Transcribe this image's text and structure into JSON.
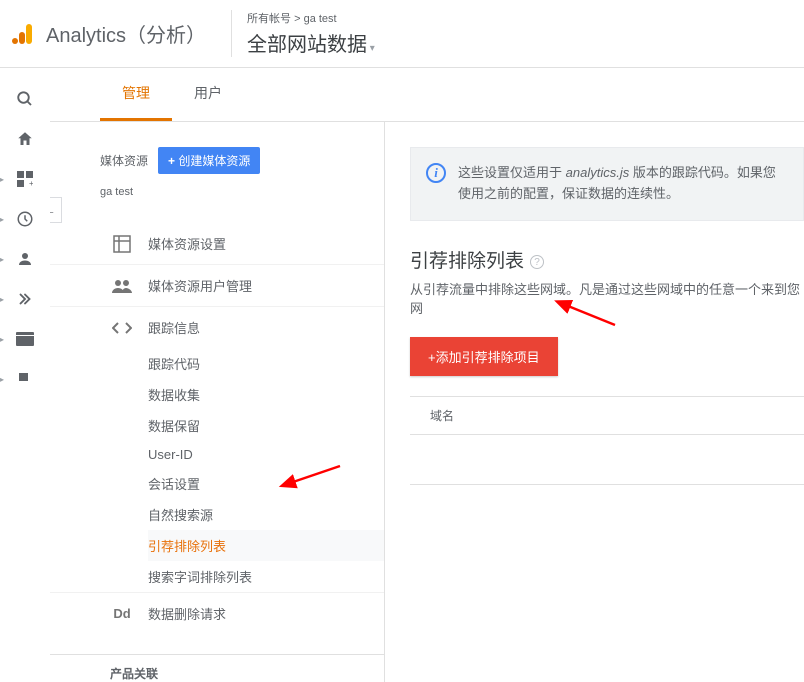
{
  "header": {
    "app_title": "Analytics（分析）",
    "breadcrumb_all": "所有帐号",
    "breadcrumb_sep": " > ",
    "breadcrumb_account": "ga test",
    "view_name": "全部网站数据"
  },
  "tabs": {
    "admin": "管理",
    "users": "用户"
  },
  "left": {
    "label": "媒体资源",
    "create_btn": "创建媒体资源",
    "property_name": "ga test",
    "items": {
      "settings": "媒体资源设置",
      "user_mgmt": "媒体资源用户管理",
      "tracking": "跟踪信息",
      "dd": "数据删除请求",
      "linking_header": "产品关联"
    },
    "tracking_sub": {
      "code": "跟踪代码",
      "collection": "数据收集",
      "retention": "数据保留",
      "userid": "User-ID",
      "session": "会话设置",
      "organic": "自然搜索源",
      "referral": "引荐排除列表",
      "search_term": "搜索字词排除列表"
    },
    "dd_prefix": "Dd"
  },
  "right": {
    "notice": "这些设置仅适用于 analytics.js 版本的跟踪代码。如果您使用之前的配置，保证数据的连续性。",
    "notice_em": "analytics.js",
    "title": "引荐排除列表",
    "desc": "从引荐流量中排除这些网域。凡是通过这些网域中的任意一个来到您网",
    "add_btn": "+添加引荐排除项目",
    "col_domain": "域名"
  },
  "colors": {
    "accent_orange": "#e37400",
    "accent_red": "#ea4335",
    "accent_blue": "#4285f4"
  }
}
